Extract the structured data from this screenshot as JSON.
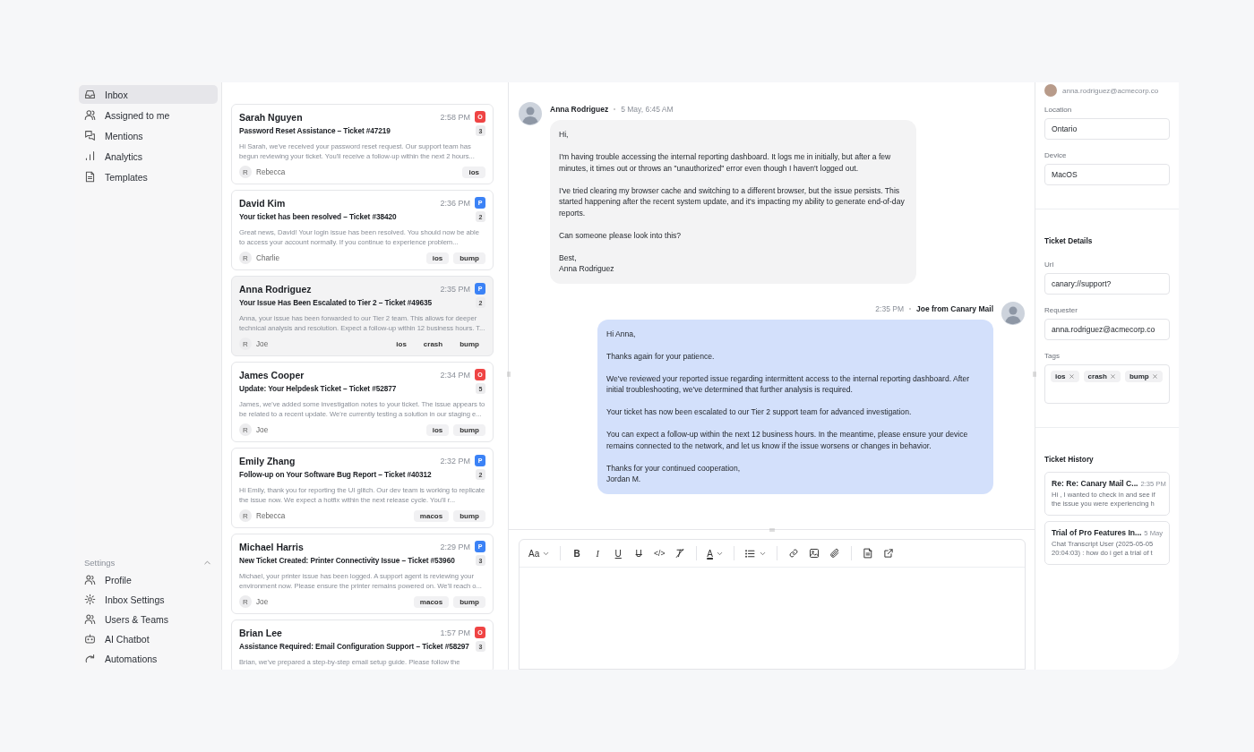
{
  "sidebar": {
    "items": [
      {
        "label": "Inbox",
        "selected": true
      },
      {
        "label": "Assigned to me",
        "selected": false
      },
      {
        "label": "Mentions",
        "selected": false
      },
      {
        "label": "Analytics",
        "selected": false
      },
      {
        "label": "Templates",
        "selected": false
      }
    ],
    "settings": {
      "title": "Settings",
      "expanded": true,
      "items": [
        {
          "label": "Profile",
          "selected": false
        },
        {
          "label": "Inbox Settings",
          "selected": false
        },
        {
          "label": "Users & Teams",
          "selected": false
        },
        {
          "label": "AI Chatbot",
          "selected": false
        },
        {
          "label": "Automations",
          "selected": false
        }
      ]
    }
  },
  "tickets": [
    {
      "name": "Sarah Nguyen",
      "time": "2:58 PM",
      "priority": "O",
      "color": "#ef4444",
      "count": "3",
      "subject": "Password Reset Assistance – Ticket #47219",
      "preview": "Hi Sarah, we've received your password reset request. Our support team has begun reviewing your ticket. You'll receive a follow-up within the next 2 hours...",
      "assignee_initial": "R",
      "assignee": "Rebecca",
      "tags": [
        "ios"
      ],
      "selected": false
    },
    {
      "name": "David Kim",
      "time": "2:36 PM",
      "priority": "P",
      "color": "#3b82f6",
      "count": "2",
      "subject": "Your ticket has been resolved – Ticket #38420",
      "preview": "Great news, David! Your login issue has been resolved. You should now be able to access your account normally. If you continue to experience problem...",
      "assignee_initial": "R",
      "assignee": "Charlie",
      "tags": [
        "ios",
        "bump"
      ],
      "selected": false
    },
    {
      "name": "Anna Rodriguez",
      "time": "2:35 PM",
      "priority": "P",
      "color": "#3b82f6",
      "count": "2",
      "subject": "Your Issue Has Been Escalated to Tier 2 – Ticket #49635",
      "preview": "Anna, your issue has been forwarded to our Tier 2 team. This allows for deeper technical analysis and resolution. Expect a follow-up within 12 business hours. T...",
      "assignee_initial": "R",
      "assignee": "Joe",
      "tags": [
        "ios",
        "crash",
        "bump"
      ],
      "selected": true
    },
    {
      "name": "James Cooper",
      "time": "2:34 PM",
      "priority": "O",
      "color": "#ef4444",
      "count": "5",
      "subject": "Update: Your Helpdesk Ticket – Ticket #52877",
      "preview": "James, we've added some investigation notes to your ticket. The issue appears to be related to a recent update. We're currently testing a solution in our staging e...",
      "assignee_initial": "R",
      "assignee": "Joe",
      "tags": [
        "ios",
        "bump"
      ],
      "selected": false
    },
    {
      "name": "Emily Zhang",
      "time": "2:32 PM",
      "priority": "P",
      "color": "#3b82f6",
      "count": "2",
      "subject": "Follow-up on Your Software Bug Report – Ticket #40312",
      "preview": "Hi Emily, thank you for reporting the UI glitch. Our dev team is working to replicate the issue now. We expect a hotfix within the next release cycle. You'll r...",
      "assignee_initial": "R",
      "assignee": "Rebecca",
      "tags": [
        "macos",
        "bump"
      ],
      "selected": false
    },
    {
      "name": "Michael Harris",
      "time": "2:29 PM",
      "priority": "P",
      "color": "#3b82f6",
      "count": "3",
      "subject": "New Ticket Created: Printer Connectivity Issue – Ticket #53960",
      "preview": "Michael, your printer issue has been logged. A support agent is reviewing your environment now. Please ensure the printer remains powered on. We'll reach o...",
      "assignee_initial": "R",
      "assignee": "Joe",
      "tags": [
        "macos",
        "bump"
      ],
      "selected": false
    },
    {
      "name": "Brian Lee",
      "time": "1:57 PM",
      "priority": "O",
      "color": "#ef4444",
      "count": "3",
      "subject": "Assistance Required: Email Configuration Support – Ticket #58297",
      "preview": "Brian, we've prepared a step-by-step email setup guide. Please follow the",
      "selected": false
    }
  ],
  "conversation": {
    "messages": [
      {
        "kind": "incoming",
        "author": "Anna Rodriguez",
        "time": "5 May, 6:45 AM",
        "paragraphs": [
          "Hi,",
          "I'm having trouble accessing the internal reporting dashboard. It logs me in initially, but after a few minutes, it times out or throws an \"unauthorized\" error even though I haven't logged out.",
          "I've tried clearing my browser cache and switching to a different browser, but the issue persists. This started happening after the recent system update, and it's impacting my ability to generate end-of-day reports.",
          "Can someone please look into this?",
          "Best,\nAnna Rodriguez"
        ]
      },
      {
        "kind": "outgoing",
        "author": "Joe from Canary Mail",
        "time": "2:35 PM",
        "paragraphs": [
          "Hi Anna,",
          "Thanks again for your patience.",
          "We've reviewed your reported issue regarding intermittent access to the internal reporting dashboard. After initial troubleshooting, we've determined that further analysis is required.",
          "Your ticket has now been escalated to our Tier 2 support team for advanced investigation.",
          "You can expect a follow-up within the next 12 business hours. In the meantime, please ensure your device remains connected to the network, and let us know if the issue worsens or changes in behavior.",
          "Thanks for your continued cooperation,\nJordan M."
        ]
      }
    ],
    "toolbar": [
      {
        "kind": "font",
        "label": "Aa"
      },
      {
        "kind": "separator"
      },
      {
        "kind": "bold",
        "label": "B"
      },
      {
        "kind": "italic",
        "label": "I"
      },
      {
        "kind": "underline",
        "label": "U"
      },
      {
        "kind": "strike",
        "label": "U"
      },
      {
        "kind": "code",
        "label": "</>"
      },
      {
        "kind": "clear"
      },
      {
        "kind": "separator"
      },
      {
        "kind": "color",
        "label": "A"
      },
      {
        "kind": "separator"
      },
      {
        "kind": "list"
      },
      {
        "kind": "separator"
      },
      {
        "kind": "link"
      },
      {
        "kind": "image"
      },
      {
        "kind": "attach"
      },
      {
        "kind": "separator"
      },
      {
        "kind": "document"
      },
      {
        "kind": "external"
      }
    ]
  },
  "details": {
    "email": "anna.rodriguez@acmecorp.co",
    "fields": [
      {
        "label": "Location",
        "value": "Ontario"
      },
      {
        "label": "Device",
        "value": "MacOS"
      }
    ],
    "ticket_details": {
      "title": "Ticket Details",
      "fields": [
        {
          "label": "Url",
          "value": "canary://support?"
        },
        {
          "label": "Requester",
          "value": "anna.rodriguez@acmecorp.co"
        }
      ],
      "tags_label": "Tags",
      "tags": [
        "ios",
        "crash",
        "bump"
      ]
    },
    "history": {
      "title": "Ticket History",
      "items": [
        {
          "title": "Re: Re: Canary Mail C...",
          "time": "2:35 PM",
          "preview": "Hi , I wanted to check in and see if the issue you were experiencing h"
        },
        {
          "title": "Trial of Pro Features In...",
          "time": "5 May",
          "preview": "Chat Transcript User (2025-05-05 20:04:03) : how do i get a trial of t"
        }
      ]
    }
  }
}
